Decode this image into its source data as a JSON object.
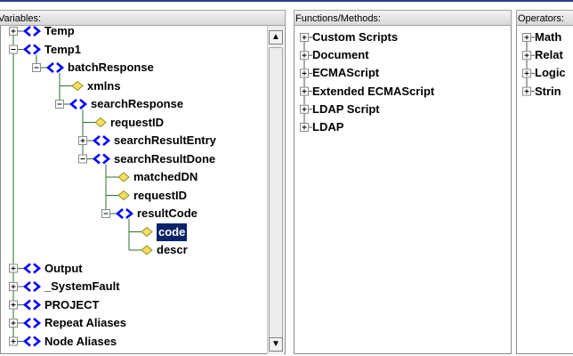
{
  "panels": {
    "variables": {
      "title": "Variables:"
    },
    "functions": {
      "title": "Functions/Methods:"
    },
    "operators": {
      "title": "Operators:"
    }
  },
  "variables_tree": [
    {
      "label": "Temp",
      "type": "element",
      "expander": "plus",
      "depth": 0
    },
    {
      "label": "Temp1",
      "type": "element",
      "expander": "minus",
      "depth": 0
    },
    {
      "label": "batchResponse",
      "type": "element",
      "expander": "minus",
      "depth": 1
    },
    {
      "label": "xmlns",
      "type": "attribute",
      "expander": "none",
      "depth": 2
    },
    {
      "label": "searchResponse",
      "type": "element",
      "expander": "minus",
      "depth": 2
    },
    {
      "label": "requestID",
      "type": "attribute",
      "expander": "none",
      "depth": 3
    },
    {
      "label": "searchResultEntry",
      "type": "element",
      "expander": "plus",
      "depth": 3
    },
    {
      "label": "searchResultDone",
      "type": "element",
      "expander": "minus",
      "depth": 3
    },
    {
      "label": "matchedDN",
      "type": "attribute",
      "expander": "none",
      "depth": 4
    },
    {
      "label": "requestID",
      "type": "attribute",
      "expander": "none",
      "depth": 4
    },
    {
      "label": "resultCode",
      "type": "element",
      "expander": "minus",
      "depth": 4
    },
    {
      "label": "code",
      "type": "attribute",
      "expander": "none",
      "depth": 5,
      "selected": true
    },
    {
      "label": "descr",
      "type": "attribute",
      "expander": "none",
      "depth": 5
    },
    {
      "label": "Output",
      "type": "element",
      "expander": "plus",
      "depth": 0
    },
    {
      "label": "_SystemFault",
      "type": "element",
      "expander": "plus",
      "depth": 0
    },
    {
      "label": "PROJECT",
      "type": "element",
      "expander": "plus",
      "depth": 0
    },
    {
      "label": "Repeat Aliases",
      "type": "element",
      "expander": "plus",
      "depth": 0
    },
    {
      "label": "Node Aliases",
      "type": "element",
      "expander": "plus",
      "depth": 0
    }
  ],
  "functions_list": [
    "Custom Scripts",
    "Document",
    "ECMAScript",
    "Extended ECMAScript",
    "LDAP Script",
    "LDAP"
  ],
  "operators_list": [
    "Math",
    "Relat",
    "Logic",
    "Strin"
  ],
  "scrollbar": {
    "up_icon": "scroll-up-arrow-icon",
    "down_icon": "scroll-down-arrow-icon"
  },
  "colors": {
    "element_icon": "#0000ff",
    "tree_line": "#2d6e2d",
    "attribute_icon": "#f0e060",
    "selection": "#0a246a"
  }
}
